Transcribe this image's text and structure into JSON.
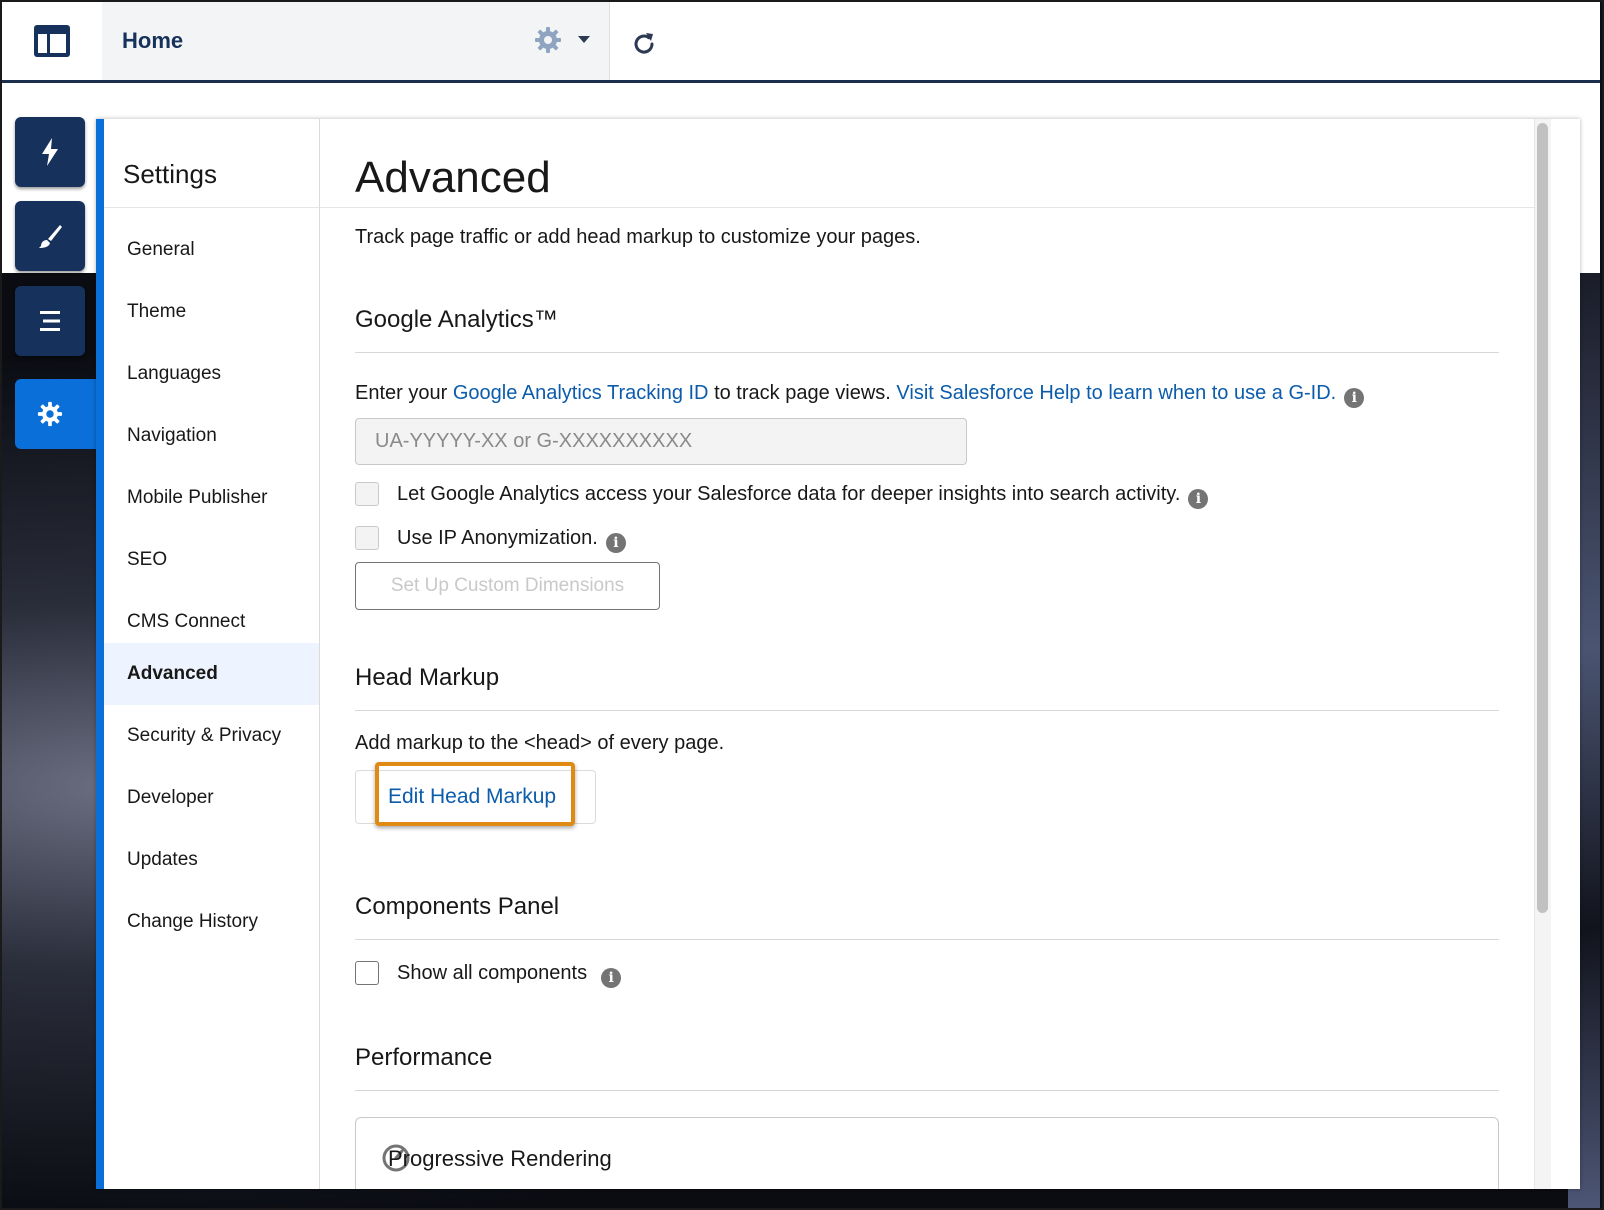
{
  "topbar": {
    "title": "Home",
    "icons": {
      "menu": "layout-panel-icon",
      "gear": "gear-icon",
      "dropdown": "chevron-down-icon",
      "refresh": "refresh-icon"
    }
  },
  "rail": {
    "items": [
      {
        "name": "lightning-icon"
      },
      {
        "name": "brush-icon"
      },
      {
        "name": "list-icon"
      },
      {
        "name": "settings-gear-icon",
        "active": true
      }
    ]
  },
  "settings": {
    "title": "Settings",
    "nav": [
      "General",
      "Theme",
      "Languages",
      "Navigation",
      "Mobile Publisher",
      "SEO",
      "CMS Connect",
      "Advanced",
      "Security & Privacy",
      "Developer",
      "Updates",
      "Change History"
    ],
    "active": "Advanced"
  },
  "advanced": {
    "title": "Advanced",
    "description": "Track page traffic or add head markup to customize your pages.",
    "google": {
      "heading": "Google Analytics™",
      "prefix": "Enter your ",
      "link1": "Google Analytics Tracking ID",
      "middle": " to track page views. ",
      "link2": "Visit Salesforce Help to learn when to use a G-ID.",
      "placeholder": "UA-YYYYY-XX or G-XXXXXXXXXX",
      "check1": "Let Google Analytics access your Salesforce data for deeper insights into search activity.",
      "check2": "Use IP Anonymization.",
      "button": "Set Up Custom Dimensions"
    },
    "head": {
      "heading": "Head Markup",
      "text": "Add markup to the <head> of every page.",
      "button": "Edit Head Markup"
    },
    "components": {
      "heading": "Components Panel",
      "check": "Show all components"
    },
    "performance": {
      "heading": "Performance",
      "item": "Progressive Rendering"
    },
    "info_glyph": "i"
  },
  "colors": {
    "brand": "#0a6fd9",
    "navy": "#16325c",
    "link": "#0b5cab",
    "highlight": "#df8a13"
  }
}
